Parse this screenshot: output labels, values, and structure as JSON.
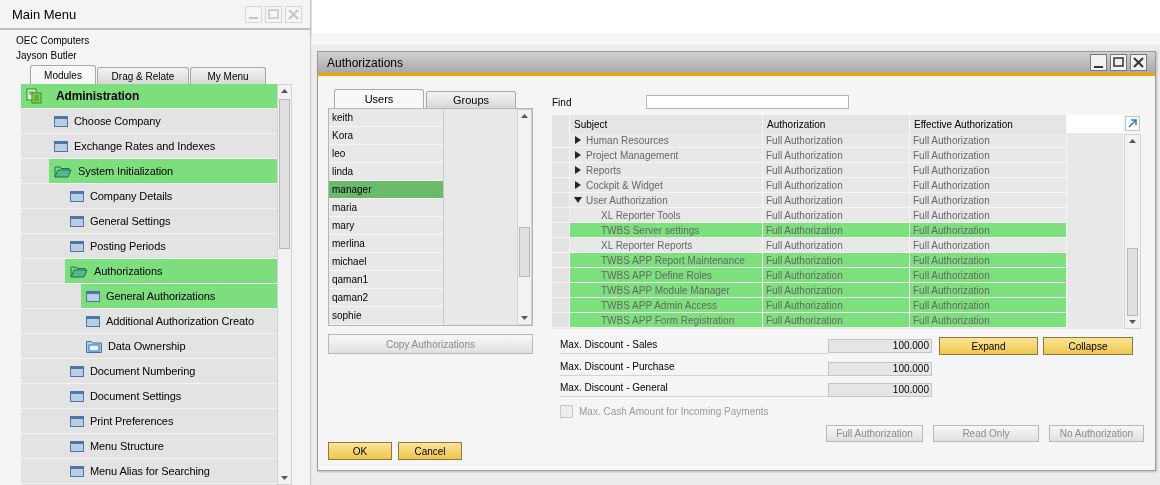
{
  "main_menu": {
    "title": "Main Menu",
    "company": "OEC Computers",
    "user": "Jayson Butler",
    "tabs": [
      {
        "label": "Modules",
        "selected": true
      },
      {
        "label": "Drag & Relate",
        "selected": false
      },
      {
        "label": "My Menu",
        "selected": false
      }
    ],
    "tree": [
      {
        "label": "Administration",
        "kind": "module",
        "selected": true,
        "children": [
          {
            "label": "Choose Company",
            "kind": "window",
            "selected": false
          },
          {
            "label": "Exchange Rates and Indexes",
            "kind": "window",
            "selected": false
          },
          {
            "label": "System Initialization",
            "kind": "folder",
            "expanded": true,
            "selected": true,
            "children": [
              {
                "label": "Company Details",
                "kind": "window",
                "selected": false
              },
              {
                "label": "General Settings",
                "kind": "window",
                "selected": false
              },
              {
                "label": "Posting Periods",
                "kind": "window",
                "selected": false
              },
              {
                "label": "Authorizations",
                "kind": "folder",
                "expanded": true,
                "selected": true,
                "children": [
                  {
                    "label": "General Authorizations",
                    "kind": "window",
                    "selected": true
                  },
                  {
                    "label": "Additional Authorization Creato",
                    "kind": "window",
                    "selected": false
                  },
                  {
                    "label": "Data Ownership",
                    "kind": "folder",
                    "expanded": false,
                    "selected": false
                  }
                ]
              },
              {
                "label": "Document Numbering",
                "kind": "window",
                "selected": false
              },
              {
                "label": "Document Settings",
                "kind": "window",
                "selected": false
              },
              {
                "label": "Print Preferences",
                "kind": "window",
                "selected": false
              },
              {
                "label": "Menu Structure",
                "kind": "window",
                "selected": false
              },
              {
                "label": "Menu Alias for Searching",
                "kind": "window",
                "selected": false
              }
            ]
          }
        ]
      }
    ]
  },
  "dialog": {
    "title": "Authorizations",
    "tabs": [
      {
        "label": "Users",
        "selected": true
      },
      {
        "label": "Groups",
        "selected": false
      }
    ],
    "users": [
      {
        "name": "keith",
        "selected": false
      },
      {
        "name": "Kora",
        "selected": false
      },
      {
        "name": "leo",
        "selected": false
      },
      {
        "name": "linda",
        "selected": false
      },
      {
        "name": "manager",
        "selected": true
      },
      {
        "name": "maria",
        "selected": false
      },
      {
        "name": "mary",
        "selected": false
      },
      {
        "name": "merlina",
        "selected": false
      },
      {
        "name": "michael",
        "selected": false
      },
      {
        "name": "qaman1",
        "selected": false
      },
      {
        "name": "qaman2",
        "selected": false
      },
      {
        "name": "sophie",
        "selected": false
      }
    ],
    "copy_button": {
      "label": "Copy Authorizations",
      "disabled": true
    },
    "find_label": "Find",
    "columns": [
      "Subject",
      "Authorization",
      "Effective Authorization"
    ],
    "rows": [
      {
        "subject": "Human Resources",
        "authorization": "Full Authorization",
        "effective": "Full Authorization",
        "expanded": false,
        "selected": false
      },
      {
        "subject": "Project Management",
        "authorization": "Full Authorization",
        "effective": "Full Authorization",
        "expanded": false,
        "selected": false
      },
      {
        "subject": "Reports",
        "authorization": "Full Authorization",
        "effective": "Full Authorization",
        "expanded": false,
        "selected": false
      },
      {
        "subject": "Cockpit & Widget",
        "authorization": "Full Authorization",
        "effective": "Full Authorization",
        "expanded": false,
        "selected": false
      },
      {
        "subject": "User Authorization",
        "authorization": "Full Authorization",
        "effective": "Full Authorization",
        "expanded": true,
        "selected": false,
        "children": [
          {
            "subject": "XL Reporter Tools",
            "authorization": "Full Authorization",
            "effective": "Full Authorization",
            "selected": false
          },
          {
            "subject": "TWBS Server settings",
            "authorization": "Full Authorization",
            "effective": "Full Authorization",
            "selected": true
          },
          {
            "subject": "XL Reporter Reports",
            "authorization": "Full Authorization",
            "effective": "Full Authorization",
            "selected": false
          },
          {
            "subject": "TWBS APP Report Maintenance",
            "authorization": "Full Authorization",
            "effective": "Full Authorization",
            "selected": true
          },
          {
            "subject": "TWBS APP Define Roles",
            "authorization": "Full Authorization",
            "effective": "Full Authorization",
            "selected": true
          },
          {
            "subject": "TWBS APP Module Manager",
            "authorization": "Full Authorization",
            "effective": "Full Authorization",
            "selected": true
          },
          {
            "subject": "TWBS APP Admin Access",
            "authorization": "Full Authorization",
            "effective": "Full Authorization",
            "selected": true
          },
          {
            "subject": "TWBS APP Form Registration",
            "authorization": "Full Authorization",
            "effective": "Full Authorization",
            "selected": true
          }
        ]
      }
    ],
    "discounts": [
      {
        "label": "Max. Discount - Sales",
        "value": "100.000"
      },
      {
        "label": "Max. Discount - Purchase",
        "value": "100.000"
      },
      {
        "label": "Max. Discount - General",
        "value": "100.000"
      }
    ],
    "expand_button": "Expand",
    "collapse_button": "Collapse",
    "cash_option": {
      "label": "Max. Cash Amount for Incoming Payments",
      "checked": false,
      "disabled": true
    },
    "authorization_buttons": [
      {
        "label": "Full Authorization",
        "disabled": true
      },
      {
        "label": "Read Only",
        "disabled": true
      },
      {
        "label": "No Authorization",
        "disabled": true
      }
    ],
    "ok_button": "OK",
    "cancel_button": "Cancel"
  }
}
